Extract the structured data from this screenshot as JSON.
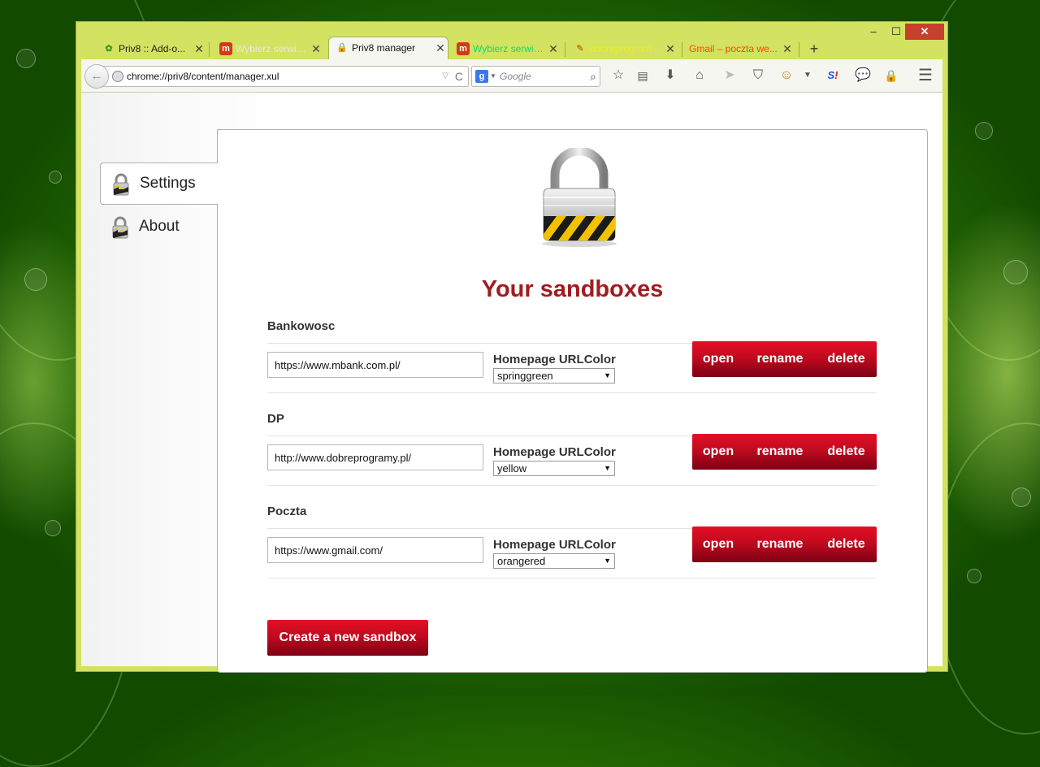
{
  "window": {
    "minimize": "–",
    "maximize": "☐",
    "close": "✕"
  },
  "tabs": [
    {
      "label": "Priv8 :: Add-o...",
      "icon": "puzzle-icon",
      "active": false,
      "color": "#222222"
    },
    {
      "label": "Wybierz serwis...",
      "icon": "m-icon",
      "active": false,
      "color": "#e8e8e8"
    },
    {
      "label": "Priv8 manager",
      "icon": "lock-icon",
      "active": true,
      "color": "#111111"
    },
    {
      "label": "Wybierz serwis...",
      "icon": "m-icon",
      "active": false,
      "color": "#17d86b"
    },
    {
      "label": "dobreprogram...",
      "icon": "dp-icon",
      "active": false,
      "color": "#f1f10a"
    },
    {
      "label": "Gmail – poczta we...",
      "icon": "none",
      "active": false,
      "color": "#ff4500"
    }
  ],
  "tab_close": "✕",
  "newtab": "+",
  "navbar": {
    "back": "←",
    "url": "chrome://priv8/content/manager.xul",
    "url_dropdown": "▽",
    "reload": "C",
    "search_engine": "g",
    "search_placeholder": "Google"
  },
  "toolbar_icons": [
    "star-icon",
    "reading-list-icon",
    "download-icon",
    "home-icon",
    "send-icon",
    "shield-icon",
    "face-icon",
    "dropdown-icon",
    "si-icon",
    "chat-icon",
    "lock-icon",
    "menu-icon"
  ],
  "sidebar": {
    "items": [
      {
        "label": "Settings",
        "selected": true
      },
      {
        "label": "About",
        "selected": false
      }
    ]
  },
  "main": {
    "title": "Your sandboxes",
    "homepage_label": "Homepage URL",
    "color_label": "Color",
    "buttons": {
      "open": "open",
      "rename": "rename",
      "delete": "delete"
    },
    "sandboxes": [
      {
        "name": "Bankowosc",
        "url": "https://www.mbank.com.pl/",
        "color": "springgreen"
      },
      {
        "name": "DP",
        "url": "http://www.dobreprogramy.pl/",
        "color": "yellow"
      },
      {
        "name": "Poczta",
        "url": "https://www.gmail.com/",
        "color": "orangered"
      }
    ],
    "create_button": "Create a new sandbox"
  },
  "colors": {
    "accent": "#a01c20",
    "button_red": "#c20a1f",
    "window_frame": "#d3e260"
  }
}
